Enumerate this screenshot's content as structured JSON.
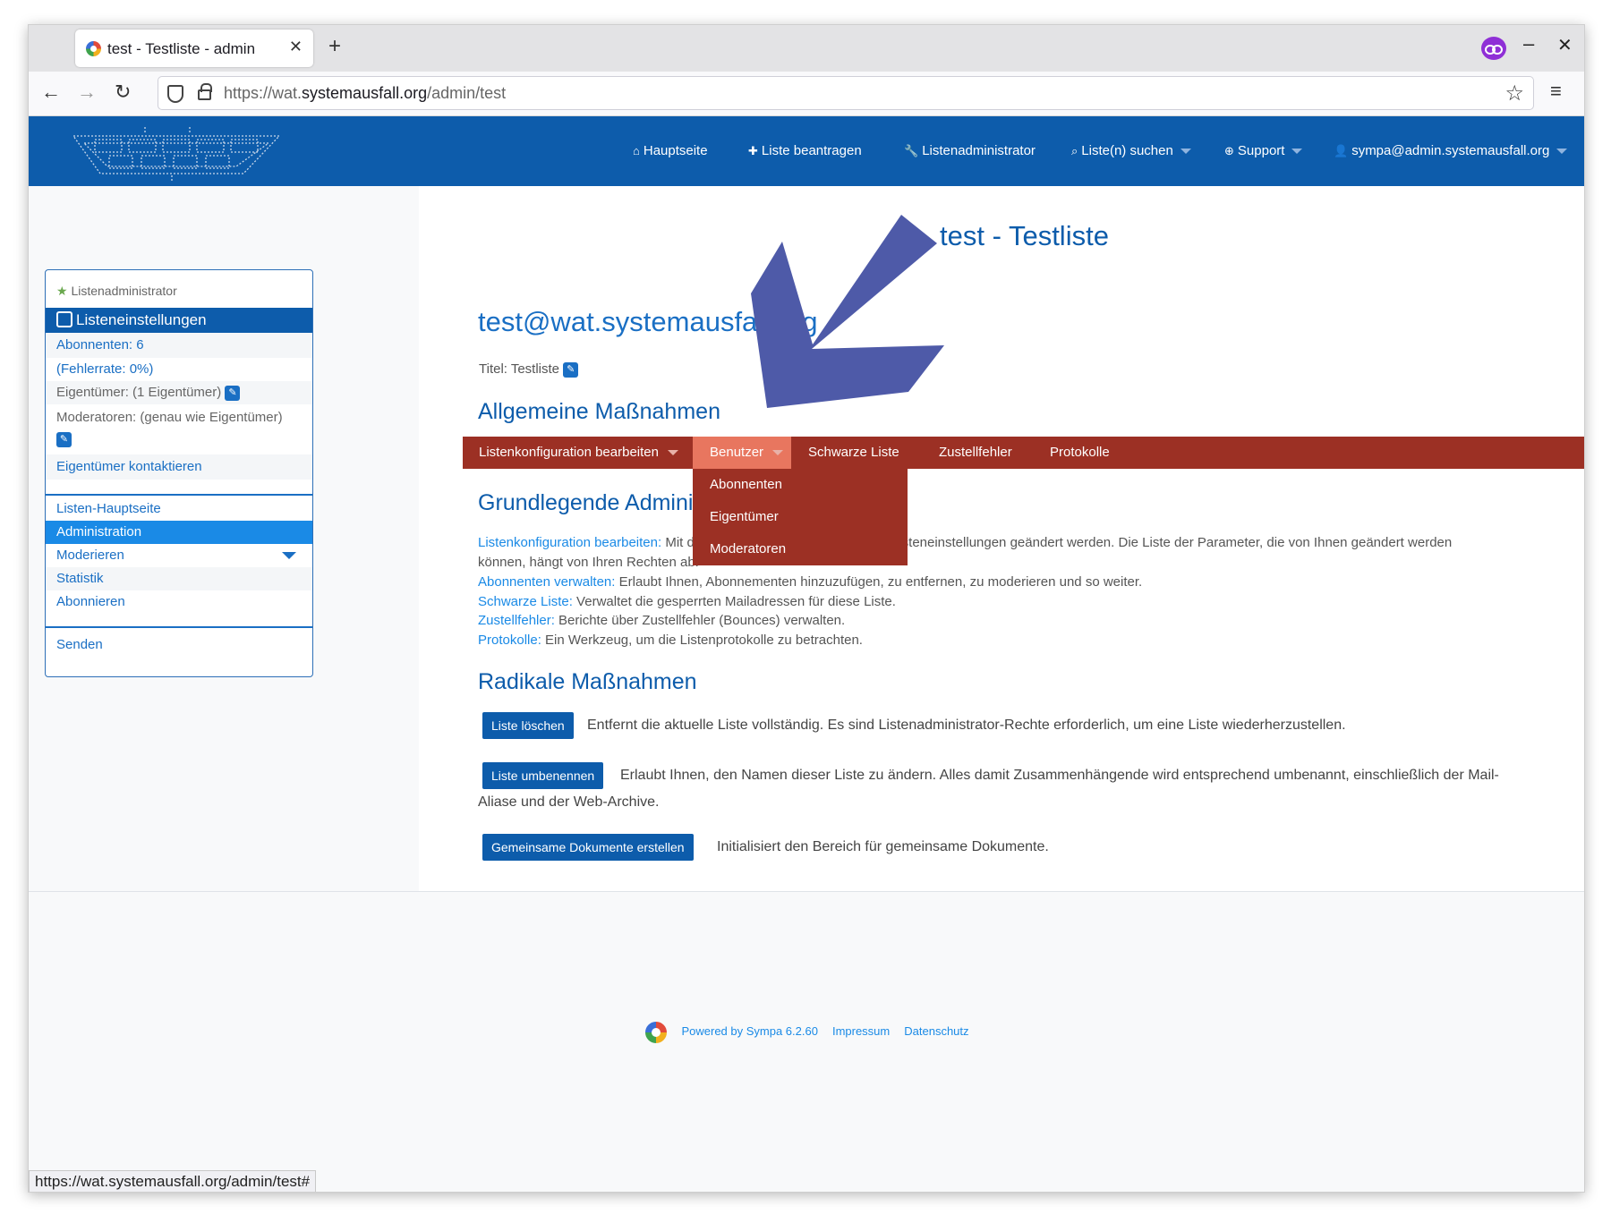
{
  "browser": {
    "tab_title": "test - Testliste - admin",
    "tab_close": "✕",
    "new_tab": "+",
    "url_prefix": "https://wat.",
    "url_host": "systemausfall.org",
    "url_path": "/admin/test",
    "status_url": "https://wat.systemausfall.org/admin/test#",
    "minimize": "–",
    "close": "✕"
  },
  "header": {
    "nav": [
      {
        "label": "Hauptseite",
        "icon": "home-icon"
      },
      {
        "label": "Liste beantragen",
        "icon": "plus-icon"
      },
      {
        "label": "Listenadministrator",
        "icon": "wrench-icon"
      },
      {
        "label": "Liste(n) suchen",
        "icon": "search-icon"
      },
      {
        "label": "Support",
        "icon": "lifebuoy-icon"
      },
      {
        "label": "sympa@admin.systemausfall.org",
        "icon": "user-icon"
      }
    ]
  },
  "sidebar": {
    "role": "Listenadministrator",
    "settings": "Listeneinstellungen",
    "subscribers": "Abonnenten: 6",
    "error_rate": "(Fehlerrate: 0%)",
    "owners": "Eigentümer: (1 Eigentümer)",
    "moderators": "Moderatoren: (genau wie Eigentümer)",
    "contact_owners": "Eigentümer kontaktieren",
    "menu": [
      "Listen-Hauptseite",
      "Administration",
      "Moderieren",
      "Statistik",
      "Abonnieren"
    ],
    "send": "Senden"
  },
  "main": {
    "title": "test - Testliste",
    "email": "test@wat.systemausfall.org",
    "titel_label": "Titel: Testliste",
    "general_heading": "Allgemeine Maßnahmen",
    "adminbar": [
      "Listenkonfiguration bearbeiten",
      "Benutzer",
      "Schwarze Liste",
      "Zustellfehler",
      "Protokolle"
    ],
    "benutzer_dropdown": [
      "Abonnenten",
      "Eigentümer",
      "Moderatoren"
    ],
    "basic_heading": "Grundlegende Administration",
    "basic": [
      {
        "link": "Listenkonfiguration bearbeiten:",
        "text": " Mit diesem Menüpunkt können einige Listeneinstellungen geändert werden. Die Liste der Parameter, die von Ihnen geändert werden"
      },
      {
        "link": "",
        "text": "können, hängt von Ihren Rechten ab."
      },
      {
        "link": "Abonnenten verwalten:",
        "text": " Erlaubt Ihnen, Abonnementen hinzuzufügen, zu entfernen, zu moderieren und so weiter."
      },
      {
        "link": "Schwarze Liste:",
        "text": " Verwaltet die gesperrten Mailadressen für diese Liste."
      },
      {
        "link": "Zustellfehler:",
        "text": " Berichte über Zustellfehler (Bounces) verwalten."
      },
      {
        "link": "Protokolle:",
        "text": " Ein Werkzeug, um die Listenprotokolle zu betrachten."
      }
    ],
    "radical_heading": "Radikale Maßnahmen",
    "delete_button": "Liste löschen",
    "delete_desc": "Entfernt die aktuelle Liste vollständig. Es sind Listenadministrator-Rechte erforderlich, um eine Liste wiederherzustellen.",
    "rename_button": "Liste umbenennen",
    "rename_desc_1": "Erlaubt Ihnen, den Namen dieser Liste zu ändern. Alles damit Zusammenhängende wird entsprechend umbenannt, einschließlich der Mail-",
    "rename_desc_2": "Aliase und der Web-Archive.",
    "docs_button": "Gemeinsame Dokumente erstellen",
    "docs_desc": "Initialisiert den Bereich für gemeinsame Dokumente."
  },
  "footer": {
    "powered": "Powered by Sympa 6.2.60",
    "impressum": "Impressum",
    "datenschutz": "Datenschutz"
  },
  "colors": {
    "header_blue": "#0d5cab",
    "admin_bar": "#9c3024",
    "active_tab": "#e8765f",
    "arrow": "#4e5aa8"
  }
}
